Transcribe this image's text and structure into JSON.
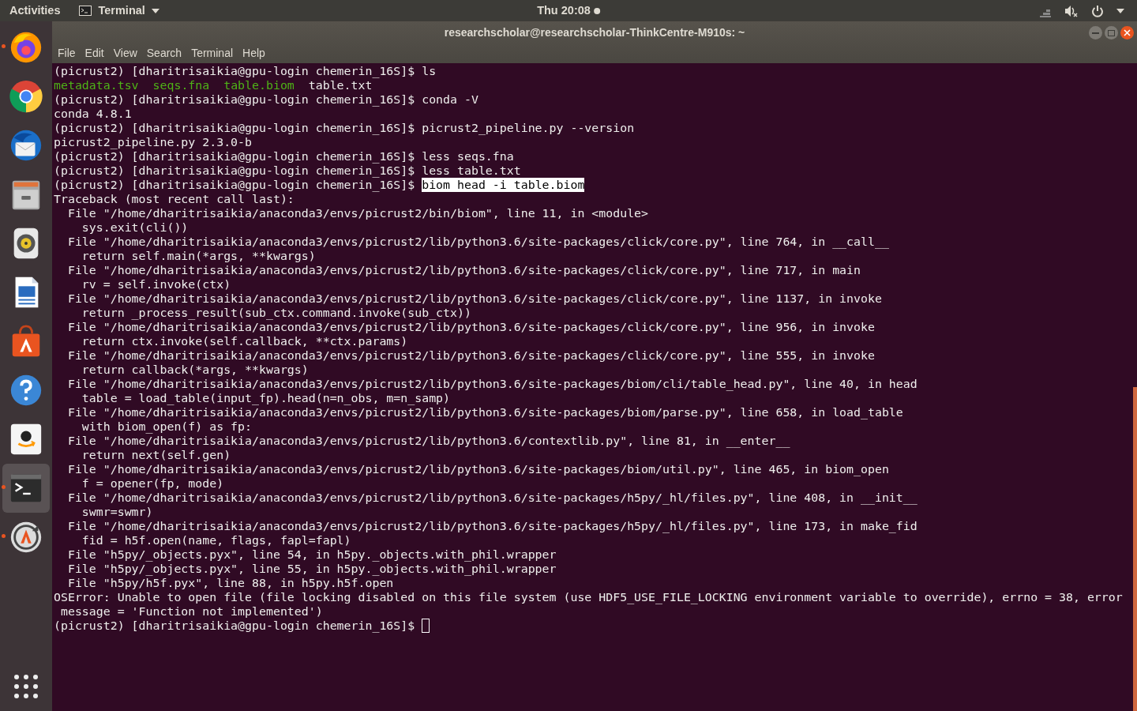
{
  "top_bar": {
    "activities": "Activities",
    "app_menu": "Terminal",
    "clock": "Thu 20:08",
    "notification": true
  },
  "dock": {
    "items": [
      {
        "running": true,
        "selected": false
      },
      {
        "running": false,
        "selected": false
      },
      {
        "running": false,
        "selected": false
      },
      {
        "running": false,
        "selected": false
      },
      {
        "running": false,
        "selected": false
      },
      {
        "running": false,
        "selected": false
      },
      {
        "running": false,
        "selected": false
      },
      {
        "running": false,
        "selected": false
      },
      {
        "running": false,
        "selected": false
      },
      {
        "running": true,
        "selected": true
      },
      {
        "running": true,
        "selected": false
      }
    ]
  },
  "window": {
    "title": "researchscholar@researchscholar-ThinkCentre-M910s: ~",
    "menu": [
      "File",
      "Edit",
      "View",
      "Search",
      "Terminal",
      "Help"
    ]
  },
  "terminal": {
    "lines": [
      {
        "segments": [
          {
            "text": "(picrust2) [dharitrisaikia@gpu-login chemerin_16S]$ ls",
            "kind": "plain"
          }
        ]
      },
      {
        "listing": true,
        "segments": [
          {
            "text": "metadata.tsv",
            "kind": "executable"
          },
          {
            "text": "seqs.fna",
            "kind": "executable"
          },
          {
            "text": "table.biom",
            "kind": "executable"
          },
          {
            "text": "table.txt",
            "kind": "plain"
          }
        ]
      },
      {
        "segments": [
          {
            "text": "(picrust2) [dharitrisaikia@gpu-login chemerin_16S]$ conda -V",
            "kind": "plain"
          }
        ]
      },
      {
        "segments": [
          {
            "text": "conda 4.8.1",
            "kind": "plain"
          }
        ]
      },
      {
        "segments": [
          {
            "text": "(picrust2) [dharitrisaikia@gpu-login chemerin_16S]$ picrust2_pipeline.py --version",
            "kind": "plain"
          }
        ]
      },
      {
        "segments": [
          {
            "text": "picrust2_pipeline.py 2.3.0-b",
            "kind": "plain"
          }
        ]
      },
      {
        "segments": [
          {
            "text": "(picrust2) [dharitrisaikia@gpu-login chemerin_16S]$ less seqs.fna",
            "kind": "plain"
          }
        ]
      },
      {
        "segments": [
          {
            "text": "(picrust2) [dharitrisaikia@gpu-login chemerin_16S]$ less table.txt",
            "kind": "plain"
          }
        ]
      },
      {
        "segments": [
          {
            "text": "(picrust2) [dharitrisaikia@gpu-login chemerin_16S]$ ",
            "kind": "plain"
          },
          {
            "text": "biom head -i table.biom",
            "kind": "selection"
          }
        ]
      },
      {
        "segments": [
          {
            "text": "Traceback (most recent call last):",
            "kind": "plain"
          }
        ]
      },
      {
        "segments": [
          {
            "text": "  File \"/home/dharitrisaikia/anaconda3/envs/picrust2/bin/biom\", line 11, in <module>",
            "kind": "plain"
          }
        ]
      },
      {
        "segments": [
          {
            "text": "    sys.exit(cli())",
            "kind": "plain"
          }
        ]
      },
      {
        "segments": [
          {
            "text": "  File \"/home/dharitrisaikia/anaconda3/envs/picrust2/lib/python3.6/site-packages/click/core.py\", line 764, in __call__",
            "kind": "plain"
          }
        ]
      },
      {
        "segments": [
          {
            "text": "    return self.main(*args, **kwargs)",
            "kind": "plain"
          }
        ]
      },
      {
        "segments": [
          {
            "text": "  File \"/home/dharitrisaikia/anaconda3/envs/picrust2/lib/python3.6/site-packages/click/core.py\", line 717, in main",
            "kind": "plain"
          }
        ]
      },
      {
        "segments": [
          {
            "text": "    rv = self.invoke(ctx)",
            "kind": "plain"
          }
        ]
      },
      {
        "segments": [
          {
            "text": "  File \"/home/dharitrisaikia/anaconda3/envs/picrust2/lib/python3.6/site-packages/click/core.py\", line 1137, in invoke",
            "kind": "plain"
          }
        ]
      },
      {
        "segments": [
          {
            "text": "    return _process_result(sub_ctx.command.invoke(sub_ctx))",
            "kind": "plain"
          }
        ]
      },
      {
        "segments": [
          {
            "text": "  File \"/home/dharitrisaikia/anaconda3/envs/picrust2/lib/python3.6/site-packages/click/core.py\", line 956, in invoke",
            "kind": "plain"
          }
        ]
      },
      {
        "segments": [
          {
            "text": "    return ctx.invoke(self.callback, **ctx.params)",
            "kind": "plain"
          }
        ]
      },
      {
        "segments": [
          {
            "text": "  File \"/home/dharitrisaikia/anaconda3/envs/picrust2/lib/python3.6/site-packages/click/core.py\", line 555, in invoke",
            "kind": "plain"
          }
        ]
      },
      {
        "segments": [
          {
            "text": "    return callback(*args, **kwargs)",
            "kind": "plain"
          }
        ]
      },
      {
        "segments": [
          {
            "text": "  File \"/home/dharitrisaikia/anaconda3/envs/picrust2/lib/python3.6/site-packages/biom/cli/table_head.py\", line 40, in head",
            "kind": "plain"
          }
        ]
      },
      {
        "segments": [
          {
            "text": "    table = load_table(input_fp).head(n=n_obs, m=n_samp)",
            "kind": "plain"
          }
        ]
      },
      {
        "segments": [
          {
            "text": "  File \"/home/dharitrisaikia/anaconda3/envs/picrust2/lib/python3.6/site-packages/biom/parse.py\", line 658, in load_table",
            "kind": "plain"
          }
        ]
      },
      {
        "segments": [
          {
            "text": "    with biom_open(f) as fp:",
            "kind": "plain"
          }
        ]
      },
      {
        "segments": [
          {
            "text": "  File \"/home/dharitrisaikia/anaconda3/envs/picrust2/lib/python3.6/contextlib.py\", line 81, in __enter__",
            "kind": "plain"
          }
        ]
      },
      {
        "segments": [
          {
            "text": "    return next(self.gen)",
            "kind": "plain"
          }
        ]
      },
      {
        "segments": [
          {
            "text": "  File \"/home/dharitrisaikia/anaconda3/envs/picrust2/lib/python3.6/site-packages/biom/util.py\", line 465, in biom_open",
            "kind": "plain"
          }
        ]
      },
      {
        "segments": [
          {
            "text": "    f = opener(fp, mode)",
            "kind": "plain"
          }
        ]
      },
      {
        "segments": [
          {
            "text": "  File \"/home/dharitrisaikia/anaconda3/envs/picrust2/lib/python3.6/site-packages/h5py/_hl/files.py\", line 408, in __init__",
            "kind": "plain"
          }
        ]
      },
      {
        "segments": [
          {
            "text": "    swmr=swmr)",
            "kind": "plain"
          }
        ]
      },
      {
        "segments": [
          {
            "text": "  File \"/home/dharitrisaikia/anaconda3/envs/picrust2/lib/python3.6/site-packages/h5py/_hl/files.py\", line 173, in make_fid",
            "kind": "plain"
          }
        ]
      },
      {
        "segments": [
          {
            "text": "    fid = h5f.open(name, flags, fapl=fapl)",
            "kind": "plain"
          }
        ]
      },
      {
        "segments": [
          {
            "text": "  File \"h5py/_objects.pyx\", line 54, in h5py._objects.with_phil.wrapper",
            "kind": "plain"
          }
        ]
      },
      {
        "segments": [
          {
            "text": "  File \"h5py/_objects.pyx\", line 55, in h5py._objects.with_phil.wrapper",
            "kind": "plain"
          }
        ]
      },
      {
        "segments": [
          {
            "text": "  File \"h5py/h5f.pyx\", line 88, in h5py.h5f.open",
            "kind": "plain"
          }
        ]
      },
      {
        "segments": [
          {
            "text": "OSError: Unable to open file (file locking disabled on this file system (use HDF5_USE_FILE_LOCKING environment variable to override), errno = 38, error",
            "kind": "plain"
          }
        ]
      },
      {
        "segments": [
          {
            "text": " message = 'Function not implemented')",
            "kind": "plain"
          }
        ]
      },
      {
        "segments": [
          {
            "text": "(picrust2) [dharitrisaikia@gpu-login chemerin_16S]$ ",
            "kind": "plain"
          }
        ],
        "cursor": true
      }
    ]
  }
}
